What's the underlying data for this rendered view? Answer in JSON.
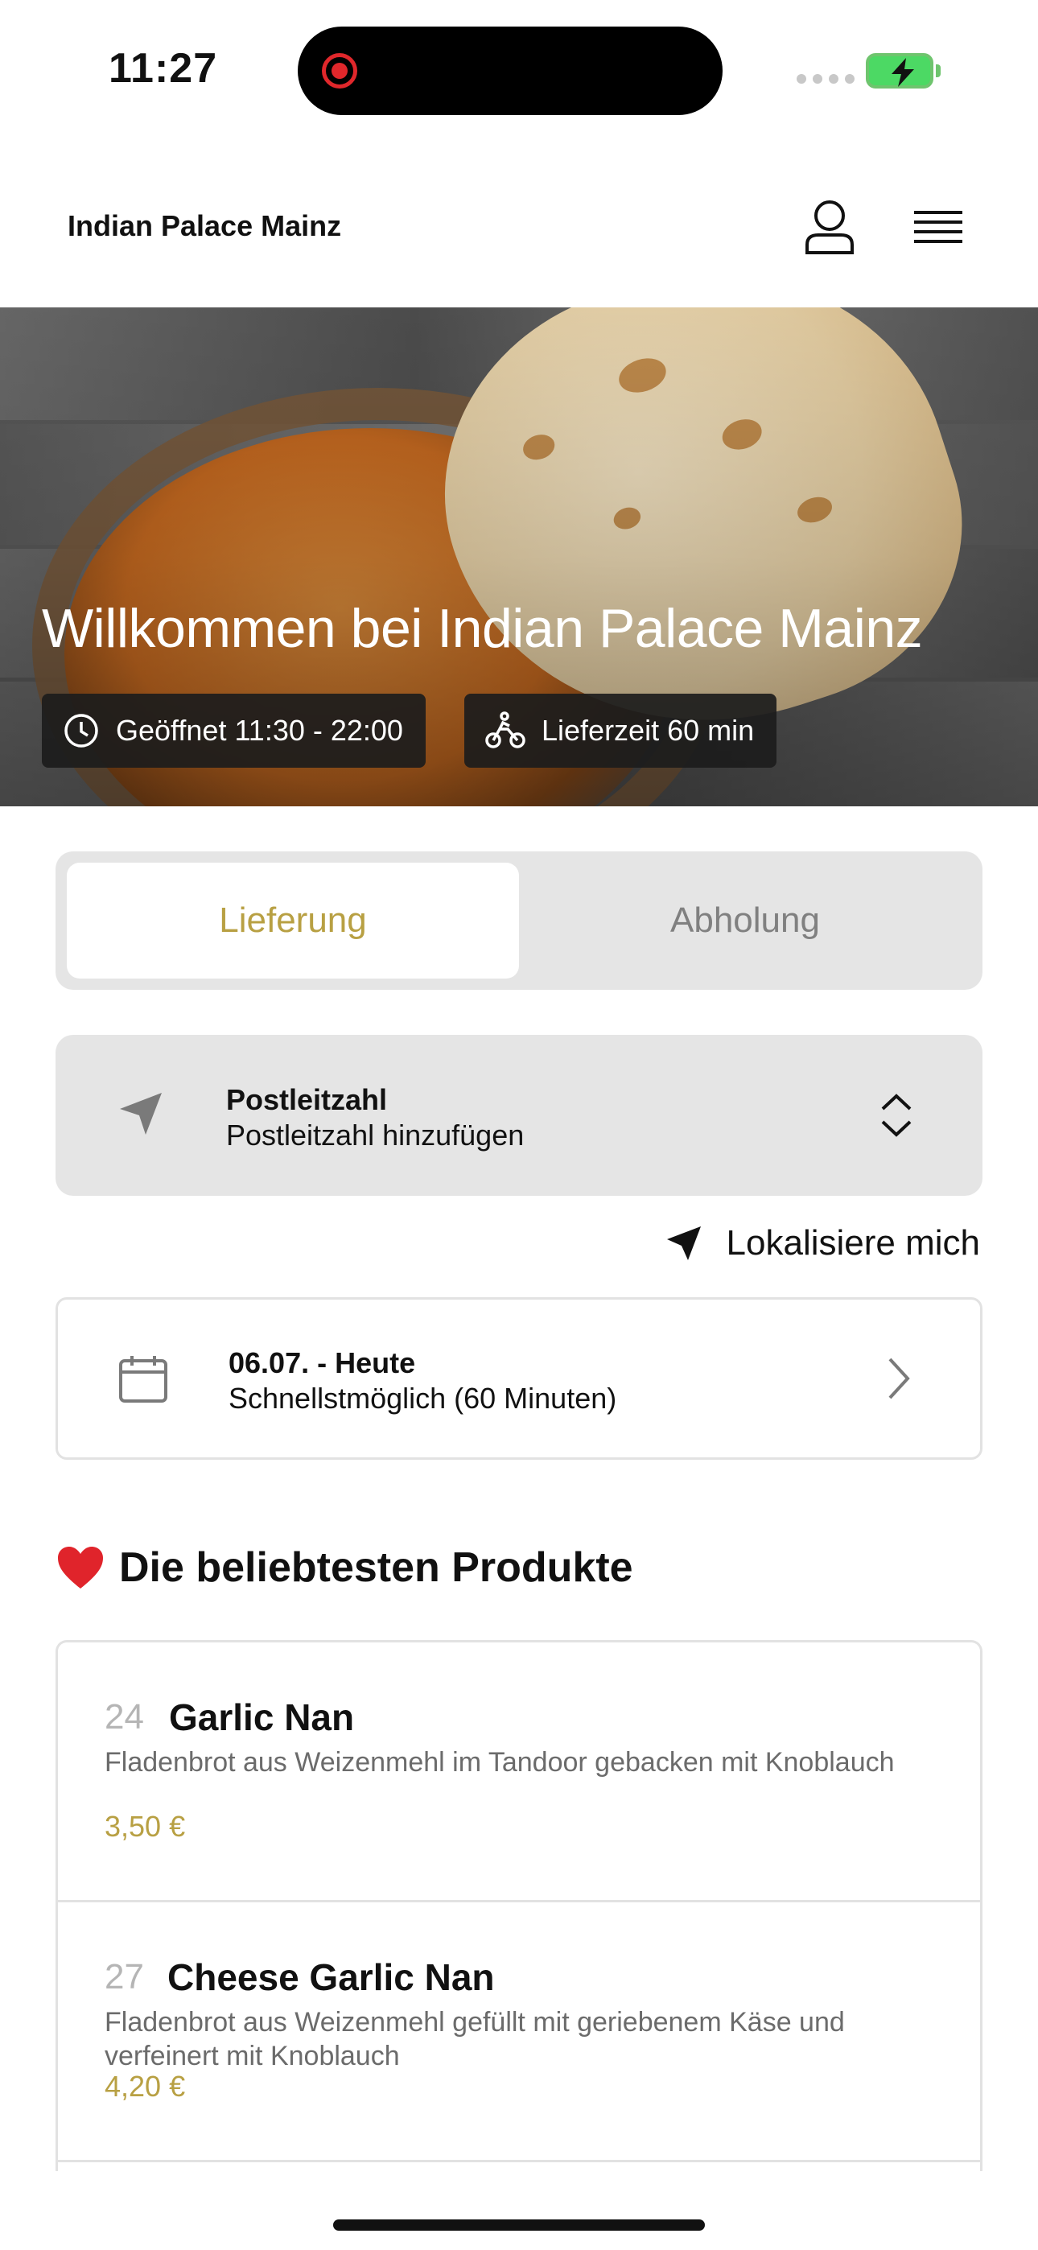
{
  "status_bar": {
    "time": "11:27"
  },
  "header": {
    "title": "Indian Palace Mainz",
    "icons": {
      "user": "user-icon",
      "menu": "hamburger-menu-icon"
    }
  },
  "hero": {
    "title": "Willkommen bei Indian Palace Mainz",
    "hours": "Geöffnet 11:30 - 22:00",
    "delivery_time": "Lieferzeit 60 min"
  },
  "mode": {
    "delivery": "Lieferung",
    "pickup": "Abholung",
    "selected": "Lieferung"
  },
  "postal": {
    "label": "Postleitzahl",
    "placeholder": "Postleitzahl hinzufügen"
  },
  "locate": {
    "label": "Lokalisiere mich"
  },
  "date": {
    "label": "06.07. - Heute",
    "value": "Schnellstmöglich (60 Minuten)"
  },
  "popular": {
    "title": "Die beliebtesten Produkte",
    "items": [
      {
        "number": "24",
        "name": "Garlic Nan",
        "description": "Fladenbrot aus Weizenmehl im Tandoor gebacken mit Knoblauch",
        "price": "3,50 €"
      },
      {
        "number": "27",
        "name": "Cheese Garlic Nan",
        "description": "Fladenbrot aus Weizenmehl gefüllt mit  geriebenem Käse und verfeinert mit Knoblauch",
        "price": "4,20 €"
      }
    ]
  },
  "colors": {
    "accent": "#b8a043",
    "panel": "#e5e5e5",
    "battery": "#4cd964",
    "record": "#e0272b"
  }
}
